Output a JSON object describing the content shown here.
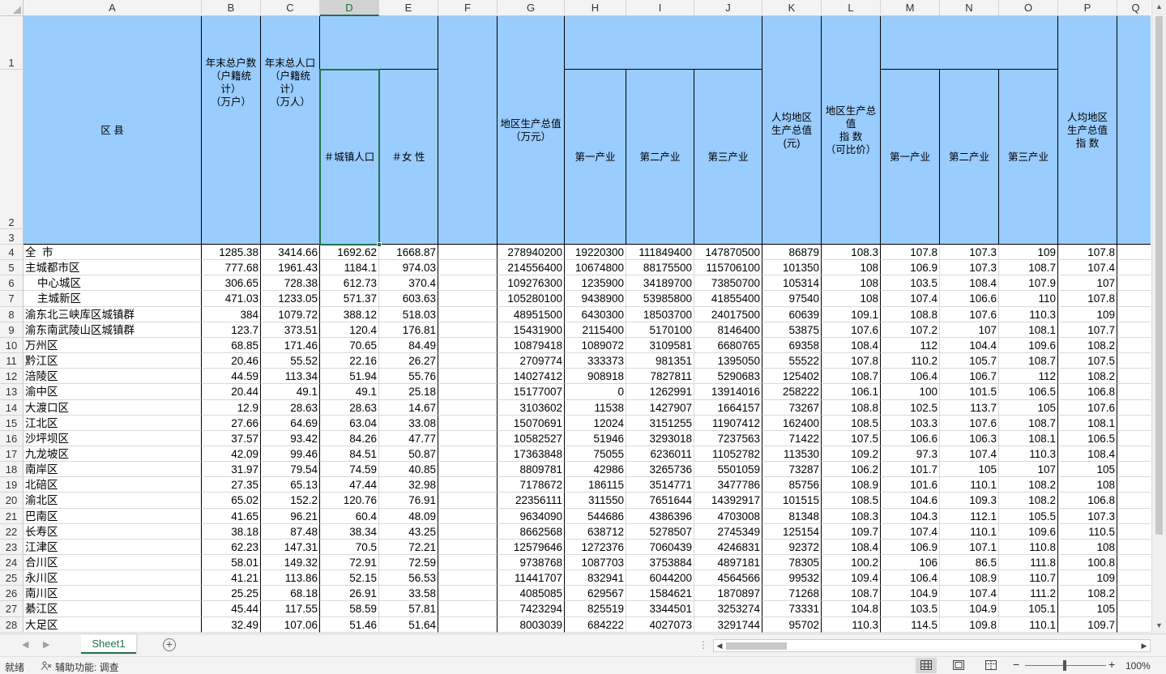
{
  "columns": [
    "A",
    "B",
    "C",
    "D",
    "E",
    "F",
    "G",
    "H",
    "I",
    "J",
    "K",
    "L",
    "M",
    "N",
    "O",
    "P",
    "Q"
  ],
  "selected_column": "D",
  "header_rows": [
    "1",
    "2",
    "3"
  ],
  "headers": {
    "region": "区  县",
    "households": "年末总户数\n（户籍统\n计）\n（万户）",
    "population": "年末总人口\n（户籍统\n计）\n（万人）",
    "urban": "＃城镇人口",
    "female": "＃女  性",
    "gdp": "地区生产总值\n（万元）",
    "primary": "第一产业",
    "secondary": "第二产业",
    "tertiary": "第三产业",
    "per_capita": "人均地区\n生产总值\n(元)",
    "gdp_index": "地区生产总\n值\n指  数\n（可比价）",
    "primary_idx": "第一产业",
    "secondary_idx": "第二产业",
    "tertiary_idx": "第三产业",
    "per_capita_idx": "人均地区\n生产总值\n指  数"
  },
  "rows": [
    {
      "n": "4",
      "name": "全  市",
      "v": [
        "1285.38",
        "3414.66",
        "1692.62",
        "1668.87",
        "",
        "278940200",
        "19220300",
        "111849400",
        "147870500",
        "86879",
        "108.3",
        "107.8",
        "107.3",
        "109",
        "107.8"
      ]
    },
    {
      "n": "5",
      "name": "主城都市区",
      "v": [
        "777.68",
        "1961.43",
        "1184.1",
        "974.03",
        "",
        "214556400",
        "10674800",
        "88175500",
        "115706100",
        "101350",
        "108",
        "106.9",
        "107.3",
        "108.7",
        "107.4"
      ]
    },
    {
      "n": "6",
      "name": "    中心城区",
      "v": [
        "306.65",
        "728.38",
        "612.73",
        "370.4",
        "",
        "109276300",
        "1235900",
        "34189700",
        "73850700",
        "105314",
        "108",
        "103.5",
        "108.4",
        "107.9",
        "107"
      ]
    },
    {
      "n": "7",
      "name": "    主城新区",
      "v": [
        "471.03",
        "1233.05",
        "571.37",
        "603.63",
        "",
        "105280100",
        "9438900",
        "53985800",
        "41855400",
        "97540",
        "108",
        "107.4",
        "106.6",
        "110",
        "107.8"
      ]
    },
    {
      "n": "8",
      "name": "渝东北三峡库区城镇群",
      "v": [
        "384",
        "1079.72",
        "388.12",
        "518.03",
        "",
        "48951500",
        "6430300",
        "18503700",
        "24017500",
        "60639",
        "109.1",
        "108.8",
        "107.6",
        "110.3",
        "109"
      ]
    },
    {
      "n": "9",
      "name": "渝东南武陵山区城镇群",
      "v": [
        "123.7",
        "373.51",
        "120.4",
        "176.81",
        "",
        "15431900",
        "2115400",
        "5170100",
        "8146400",
        "53875",
        "107.6",
        "107.2",
        "107",
        "108.1",
        "107.7"
      ]
    },
    {
      "n": "10",
      "name": "万州区",
      "v": [
        "68.85",
        "171.46",
        "70.65",
        "84.49",
        "",
        "10879418",
        "1089072",
        "3109581",
        "6680765",
        "69358",
        "108.4",
        "112",
        "104.4",
        "109.6",
        "108.2"
      ]
    },
    {
      "n": "11",
      "name": "黔江区",
      "v": [
        "20.46",
        "55.52",
        "22.16",
        "26.27",
        "",
        "2709774",
        "333373",
        "981351",
        "1395050",
        "55522",
        "107.8",
        "110.2",
        "105.7",
        "108.7",
        "107.5"
      ]
    },
    {
      "n": "12",
      "name": "涪陵区",
      "v": [
        "44.59",
        "113.34",
        "51.94",
        "55.76",
        "",
        "14027412",
        "908918",
        "7827811",
        "5290683",
        "125402",
        "108.7",
        "106.4",
        "106.7",
        "112",
        "108.2"
      ]
    },
    {
      "n": "13",
      "name": "渝中区",
      "v": [
        "20.44",
        "49.1",
        "49.1",
        "25.18",
        "",
        "15177007",
        "0",
        "1262991",
        "13914016",
        "258222",
        "106.1",
        "100",
        "101.5",
        "106.5",
        "106.8"
      ]
    },
    {
      "n": "14",
      "name": "大渡口区",
      "v": [
        "12.9",
        "28.63",
        "28.63",
        "14.67",
        "",
        "3103602",
        "11538",
        "1427907",
        "1664157",
        "73267",
        "108.8",
        "102.5",
        "113.7",
        "105",
        "107.6"
      ]
    },
    {
      "n": "15",
      "name": "江北区",
      "v": [
        "27.66",
        "64.69",
        "63.04",
        "33.08",
        "",
        "15070691",
        "12024",
        "3151255",
        "11907412",
        "162400",
        "108.5",
        "103.3",
        "107.6",
        "108.7",
        "108.1"
      ]
    },
    {
      "n": "16",
      "name": "沙坪坝区",
      "v": [
        "37.57",
        "93.42",
        "84.26",
        "47.77",
        "",
        "10582527",
        "51946",
        "3293018",
        "7237563",
        "71422",
        "107.5",
        "106.6",
        "106.3",
        "108.1",
        "106.5"
      ]
    },
    {
      "n": "17",
      "name": "九龙坡区",
      "v": [
        "42.09",
        "99.46",
        "84.51",
        "50.87",
        "",
        "17363848",
        "75055",
        "6236011",
        "11052782",
        "113530",
        "109.2",
        "97.3",
        "107.4",
        "110.3",
        "108.4"
      ]
    },
    {
      "n": "18",
      "name": "南岸区",
      "v": [
        "31.97",
        "79.54",
        "74.59",
        "40.85",
        "",
        "8809781",
        "42986",
        "3265736",
        "5501059",
        "73287",
        "106.2",
        "101.7",
        "105",
        "107",
        "105"
      ]
    },
    {
      "n": "19",
      "name": "北碚区",
      "v": [
        "27.35",
        "65.13",
        "47.44",
        "32.98",
        "",
        "7178672",
        "186115",
        "3514771",
        "3477786",
        "85756",
        "108.9",
        "101.6",
        "110.1",
        "108.2",
        "108"
      ]
    },
    {
      "n": "20",
      "name": "渝北区",
      "v": [
        "65.02",
        "152.2",
        "120.76",
        "76.91",
        "",
        "22356111",
        "311550",
        "7651644",
        "14392917",
        "101515",
        "108.5",
        "104.6",
        "109.3",
        "108.2",
        "106.8"
      ]
    },
    {
      "n": "21",
      "name": "巴南区",
      "v": [
        "41.65",
        "96.21",
        "60.4",
        "48.09",
        "",
        "9634090",
        "544686",
        "4386396",
        "4703008",
        "81348",
        "108.3",
        "104.3",
        "112.1",
        "105.5",
        "107.3"
      ]
    },
    {
      "n": "22",
      "name": "长寿区",
      "v": [
        "38.18",
        "87.48",
        "38.34",
        "43.25",
        "",
        "8662568",
        "638712",
        "5278507",
        "2745349",
        "125154",
        "109.7",
        "107.4",
        "110.1",
        "109.6",
        "110.5"
      ]
    },
    {
      "n": "23",
      "name": "江津区",
      "v": [
        "62.23",
        "147.31",
        "70.5",
        "72.21",
        "",
        "12579646",
        "1272376",
        "7060439",
        "4246831",
        "92372",
        "108.4",
        "106.9",
        "107.1",
        "110.8",
        "108"
      ]
    },
    {
      "n": "24",
      "name": "合川区",
      "v": [
        "58.01",
        "149.32",
        "72.91",
        "72.59",
        "",
        "9738768",
        "1087703",
        "3753884",
        "4897181",
        "78305",
        "100.2",
        "106",
        "86.5",
        "111.8",
        "100.8"
      ]
    },
    {
      "n": "25",
      "name": "永川区",
      "v": [
        "41.21",
        "113.86",
        "52.15",
        "56.53",
        "",
        "11441707",
        "832941",
        "6044200",
        "4564566",
        "99532",
        "109.4",
        "106.4",
        "108.9",
        "110.7",
        "109"
      ]
    },
    {
      "n": "26",
      "name": "南川区",
      "v": [
        "25.25",
        "68.18",
        "26.91",
        "33.58",
        "",
        "4085085",
        "629567",
        "1584621",
        "1870897",
        "71268",
        "108.7",
        "104.9",
        "107.4",
        "111.2",
        "108.2"
      ]
    },
    {
      "n": "27",
      "name": "綦江区",
      "v": [
        "45.44",
        "117.55",
        "58.59",
        "57.81",
        "",
        "7423294",
        "825519",
        "3344501",
        "3253274",
        "73331",
        "104.8",
        "103.5",
        "104.9",
        "105.1",
        "105"
      ]
    },
    {
      "n": "28",
      "name": "大足区",
      "v": [
        "32.49",
        "107.06",
        "51.46",
        "51.64",
        "",
        "8003039",
        "684222",
        "4027073",
        "3291744",
        "95702",
        "110.3",
        "114.5",
        "109.8",
        "110.1",
        "109.7"
      ]
    }
  ],
  "sheet_tab": "Sheet1",
  "status": {
    "ready": "就绪",
    "accessibility": "辅助功能: 调查",
    "zoom": "100%"
  },
  "icons": {
    "add_sheet": "plus-circle-icon",
    "normal_view": "grid-view-icon",
    "page_layout": "page-layout-icon",
    "page_break": "page-break-icon"
  }
}
